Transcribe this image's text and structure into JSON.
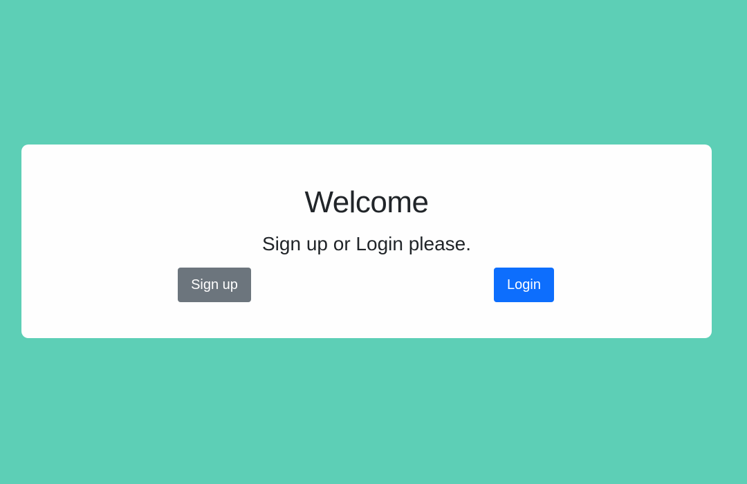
{
  "card": {
    "title": "Welcome",
    "subtitle": "Sign up or Login please.",
    "signup_label": "Sign up",
    "login_label": "Login"
  },
  "colors": {
    "background": "#5dcfb6",
    "card": "#fefefe",
    "signup_button": "#6c757d",
    "login_button": "#0d6efd",
    "text": "#212529"
  }
}
